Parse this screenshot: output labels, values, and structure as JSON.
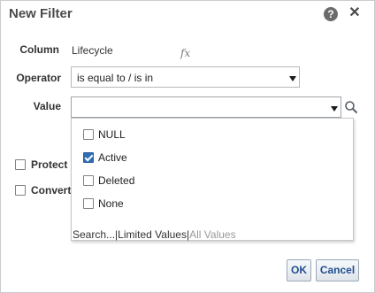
{
  "dialog": {
    "title": "New Filter",
    "help_icon": "question-circle-icon",
    "help_glyph": "?",
    "close_icon": "close-icon",
    "close_glyph": "✕"
  },
  "form": {
    "column_label": "Column",
    "column_value": "Lifecycle",
    "fx_glyph": "fx",
    "operator_label": "Operator",
    "operator_value": "is equal to / is in",
    "value_label": "Value",
    "value_input": ""
  },
  "value_dropdown": {
    "options": [
      {
        "label": "NULL",
        "checked": false
      },
      {
        "label": "Active",
        "checked": true
      },
      {
        "label": "Deleted",
        "checked": false
      },
      {
        "label": "None",
        "checked": false
      }
    ],
    "links": {
      "search": "Search...",
      "sep1": "|",
      "limited": "Limited Values",
      "sep2": "|",
      "all": "All Values"
    }
  },
  "side_options": {
    "protect": "Protect",
    "convert": "Convert"
  },
  "buttons": {
    "ok": "OK",
    "cancel": "Cancel"
  },
  "colors": {
    "accent": "#2f6db3",
    "button_text": "#1f4f8f"
  }
}
